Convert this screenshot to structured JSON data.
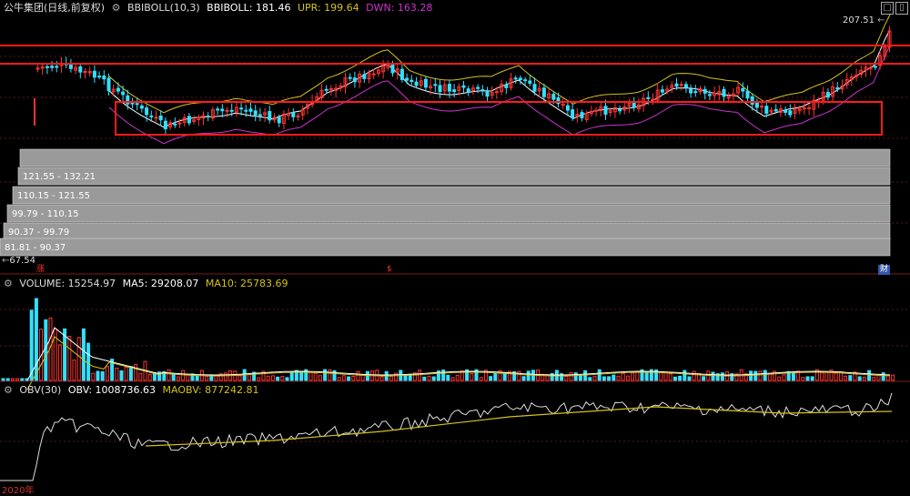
{
  "colors": {
    "up": "#ff3333",
    "down": "#33e0ff",
    "mid": "#ffffff",
    "upr": "#d4c21b",
    "dwn": "#cc33cc",
    "ma5": "#ffffff",
    "ma10": "#d4c21b",
    "red_box": "#ff1a1a",
    "volume_profile": "#9a9a9a"
  },
  "main_panel": {
    "title": "公牛集团(日线,前复权)",
    "indicator": "BBIBOLL(10,3)",
    "mid_label": "BBIBOLL: 181.46",
    "upr_label": "UPR: 199.64",
    "dwn_label": "DWN: 163.28",
    "high_marker": "207.51",
    "low_marker": "67.54",
    "window_buttons": {
      "restore": "□",
      "settings": "▯"
    }
  },
  "volume_profile": [
    {
      "label": ""
    },
    {
      "label": "121.55 - 132.21"
    },
    {
      "label": "110.15 - 121.55"
    },
    {
      "label": "99.79 - 110.15"
    },
    {
      "label": "90.37 - 99.79"
    },
    {
      "label": "81.81 - 90.37"
    }
  ],
  "event_markers": [
    {
      "label": "涨",
      "color": "#ff3333"
    },
    {
      "label": "$",
      "color": "#ff3333"
    },
    {
      "label": "财",
      "color": "#ffffff",
      "bg": "#3355aa"
    }
  ],
  "volume_panel": {
    "title": "VOLUME: 15254.97",
    "ma5": "MA5: 29208.07",
    "ma10": "MA10: 25783.69"
  },
  "obv_panel": {
    "title": "OBV(30)",
    "obv": "OBV: 1008736.63",
    "maobv": "MAOBV: 877242.81"
  },
  "x_axis": {
    "first_label": "2020年"
  }
}
